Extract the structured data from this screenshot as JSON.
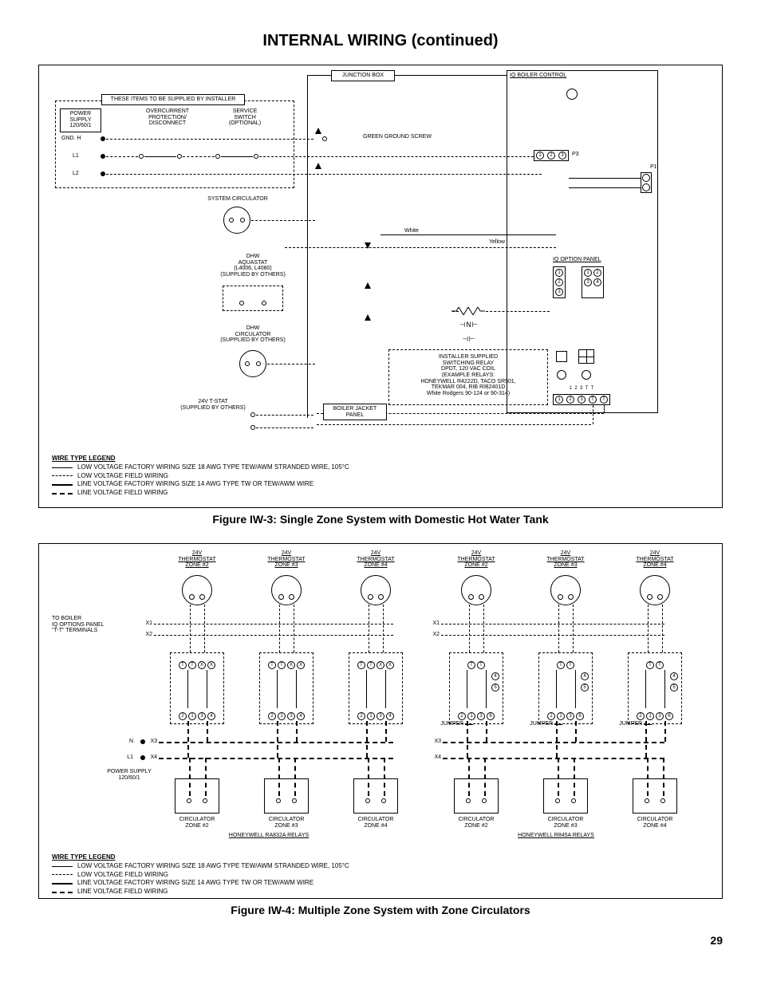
{
  "page": {
    "title": "INTERNAL WIRING (continued)",
    "number": "29"
  },
  "figure_iw3": {
    "caption": "Figure IW-3:  Single Zone System with Domestic Hot Water Tank",
    "labels": {
      "junction_box": "JUNCTION BOX",
      "iq_boiler_control": "IQ BOILER CONTROL",
      "installer_items": "THESE ITEMS TO BE SUPPLIED BY INSTALLER",
      "power_supply": "POWER\nSUPPLY\n120/60/1",
      "overcurrent": "OVERCURRENT\nPROTECTION/\nDISCONNECT",
      "service_switch": "SERVICE\nSWITCH\n(OPTIONAL)",
      "gnd": "GND. H",
      "l1": "L1",
      "l2": "L2",
      "p3": "P3",
      "p1": "P1",
      "green_ground_screw": "GREEN GROUND SCREW",
      "system_circulator": "SYSTEM CIRCULATOR",
      "white": "White",
      "yellow": "Yellow",
      "dhw_aquastat": "DHW\nAQUASTAT\n(L4006, L4080)\n(SUPPLIED BY OTHERS)",
      "dhw_circulator": "DHW\nCIRCULATOR\n(SUPPLIED BY OTHERS)",
      "iq_option_panel": "IQ OPTION PANEL",
      "relay_note": "INSTALLER SUPPLIED\nSWITCHING RELAY\nDPDT, 120 VAC COIL\n(EXAMPLE RELAYS:\nHONEYWELL R4222D, TACO SR501,\nTEKMAR 004, RIB RIB2401D\nWhite Rodgers 90-124 or 90-314)",
      "tstat": "24V T-STAT\n(SUPPLIED BY OTHERS)",
      "boiler_jacket_panel": "BOILER JACKET\nPANEL",
      "terminal_nums": [
        "1",
        "2",
        "3",
        "T",
        "T"
      ],
      "p3_terminals": [
        "1",
        "2",
        "3"
      ],
      "option_left": [
        "1",
        "2",
        "3"
      ],
      "option_right": [
        "1",
        "2",
        "3",
        "4"
      ]
    },
    "legend": {
      "title": "WIRE TYPE LEGEND",
      "rows": [
        "LOW VOLTAGE FACTORY WIRING SIZE 18 AWG TYPE TEW/AWM STRANDED WIRE, 105°C",
        "LOW VOLTAGE FIELD WIRING",
        "LINE VOLTAGE FACTORY WIRING SIZE 14 AWG TYPE TW OR TEW/AWM WIRE",
        "LINE VOLTAGE FIELD WIRING"
      ]
    }
  },
  "figure_iw4": {
    "caption": "Figure IW-4:  Multiple Zone System with Zone Circulators",
    "labels": {
      "to_boiler": "TO BOILER\nIQ OPTIONS PANEL\n\"T-T\" TERMINALS",
      "x1": "X1",
      "x2": "X2",
      "x3": "X3",
      "x4": "X4",
      "n": "N",
      "l1": "L1",
      "power_supply": "POWER SUPPLY\n120/60/1",
      "jumper": "JUMPER",
      "relays_left": "HONEYWELL RA832A RELAYS",
      "relays_right": "HONEYWELL R845A RELAYS",
      "tstat_header": "24V\nTHERMOSTAT",
      "zones": [
        "ZONE #2",
        "ZONE #3",
        "ZONE #4",
        "ZONE #2",
        "ZONE #3",
        "ZONE #4"
      ],
      "circulator": "CIRCULATOR",
      "top_terms": [
        "T",
        "T",
        "X",
        "X"
      ],
      "top_terms_r": [
        "T",
        "T"
      ],
      "side_terms_r": [
        "4",
        "5"
      ],
      "bottom_terms_l": [
        "2",
        "1",
        "3",
        "4"
      ],
      "bottom_terms_r": [
        "2",
        "1",
        "3",
        "6"
      ]
    },
    "legend": {
      "title": "WIRE TYPE LEGEND",
      "rows": [
        "LOW VOLTAGE FACTORY WIRING SIZE 18 AWG TYPE TEW/AWM STRANDED WIRE, 105°C",
        "LOW VOLTAGE FIELD WIRING",
        "LINE VOLTAGE FACTORY WIRING SIZE 14 AWG TYPE TW OR TEW/AWM WIRE",
        "LINE VOLTAGE FIELD WIRING"
      ]
    }
  }
}
